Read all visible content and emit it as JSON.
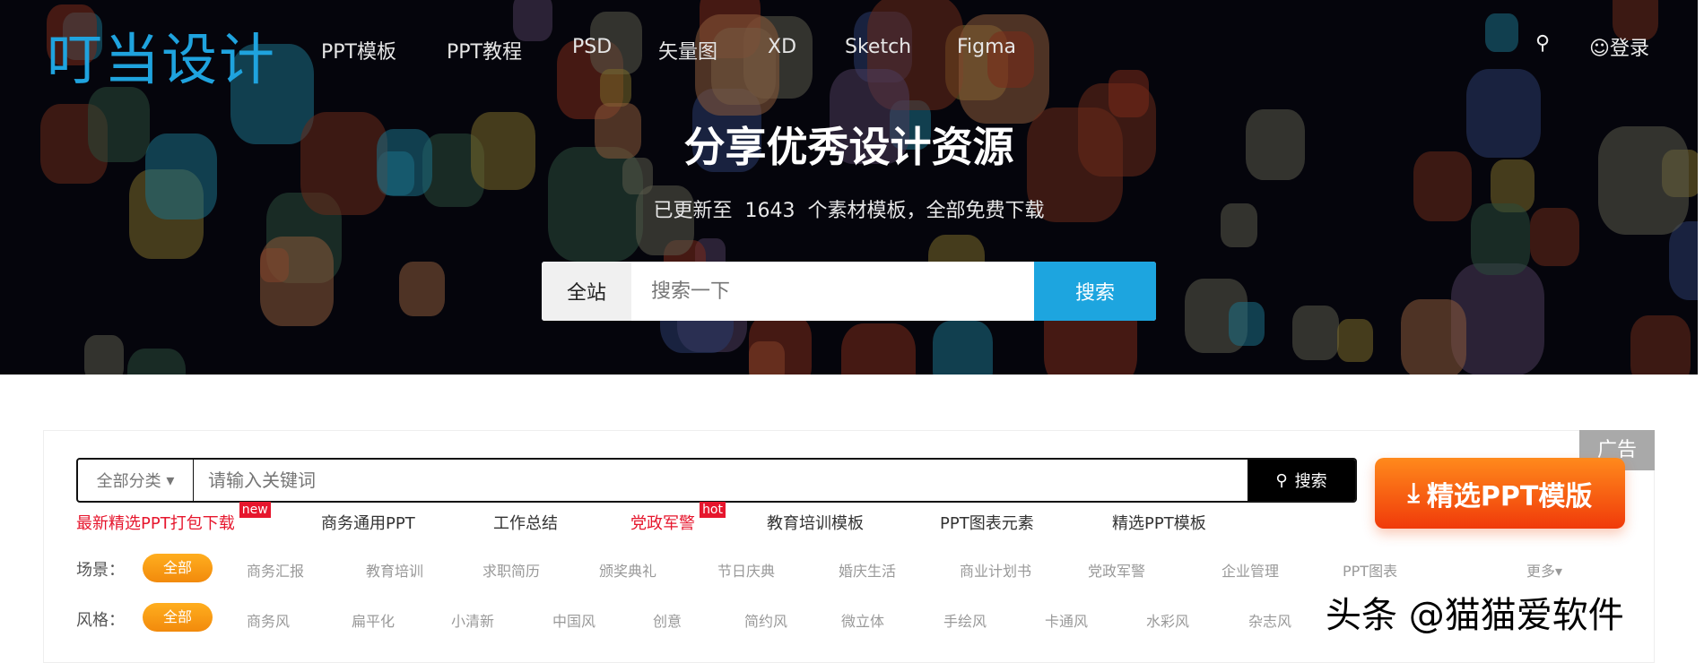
{
  "header": {
    "logo": "叮当设计",
    "nav": [
      "PPT模板",
      "PPT教程",
      "PSD",
      "矢量图",
      "XD",
      "Sketch",
      "Figma"
    ],
    "login": "登录"
  },
  "hero": {
    "title": "分享优秀设计资源",
    "subtitle": "已更新至  1643  个素材模板，全部免费下载",
    "scope": "全站",
    "placeholder": "搜索一下",
    "search_button": "搜索"
  },
  "panel": {
    "ad_tag": "广告",
    "category": "全部分类",
    "placeholder": "请输入关键词",
    "search_button": "搜索",
    "promo_button": "精选PPT模版",
    "hot_links": [
      {
        "label": "最新精选PPT打包下载",
        "badge": "new"
      },
      {
        "label": "商务通用PPT"
      },
      {
        "label": "工作总结"
      },
      {
        "label": "党政军警",
        "badge": "hot"
      },
      {
        "label": "教育培训模板"
      },
      {
        "label": "PPT图表元素"
      },
      {
        "label": "精选PPT模板"
      }
    ],
    "scene": {
      "label": "场景：",
      "active": "全部",
      "options": [
        "商务汇报",
        "教育培训",
        "求职简历",
        "颁奖典礼",
        "节日庆典",
        "婚庆生活",
        "商业计划书",
        "党政军警",
        "企业管理",
        "PPT图表"
      ],
      "more": "更多▾"
    },
    "style": {
      "label": "风格：",
      "active": "全部",
      "options": [
        "商务风",
        "扁平化",
        "小清新",
        "中国风",
        "创意",
        "简约风",
        "微立体",
        "手绘风",
        "卡通风",
        "水彩风",
        "杂志风"
      ]
    }
  },
  "watermark": "头条 @猫猫爱软件",
  "colors": {
    "brand": "#1fa3de",
    "accent": "#f28a0c",
    "red": "#e6162d"
  }
}
